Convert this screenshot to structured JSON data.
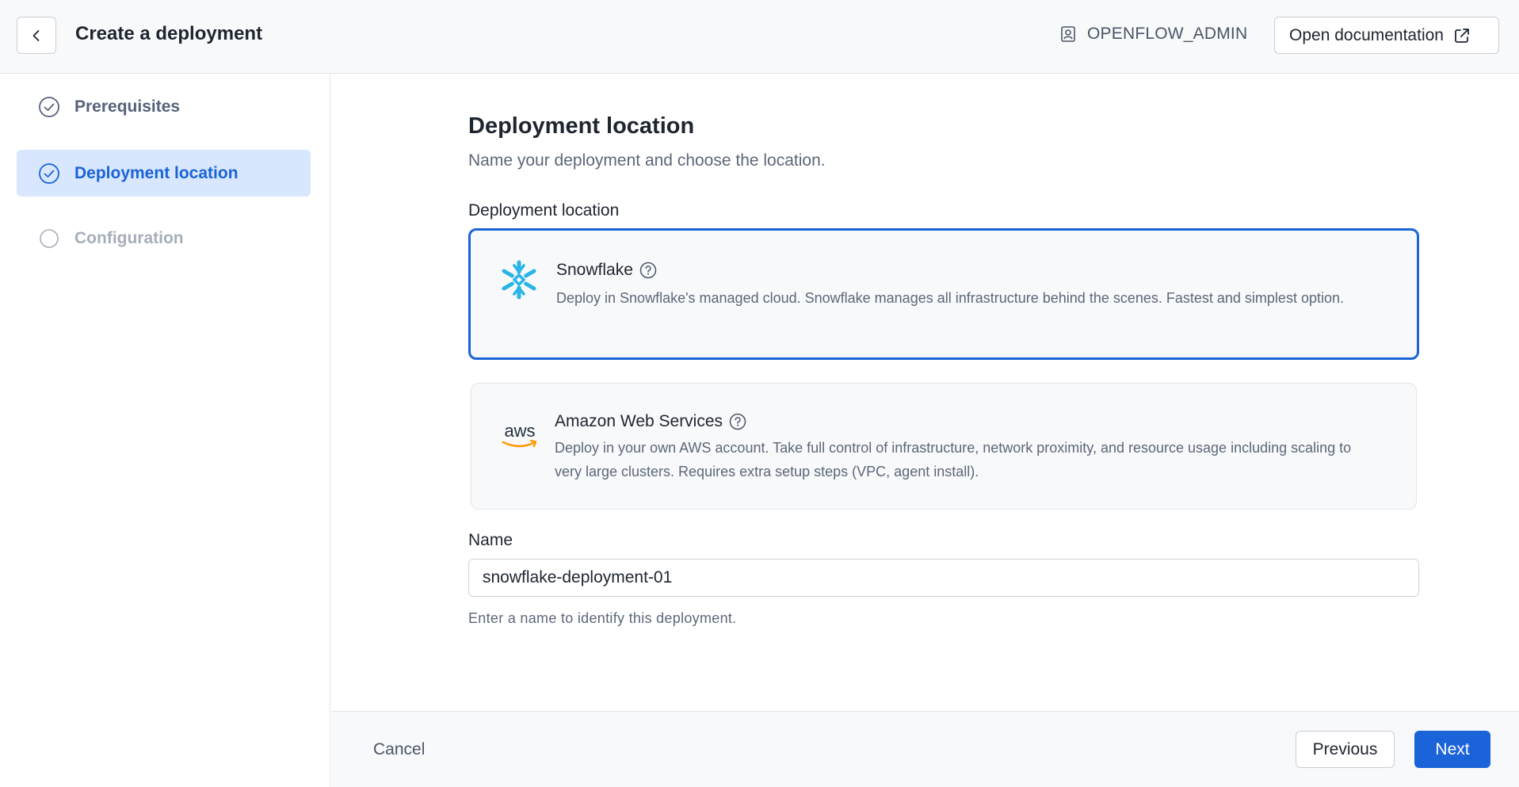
{
  "header": {
    "title": "Create a deployment",
    "user": "OPENFLOW_ADMIN",
    "doc_button": "Open documentation"
  },
  "steps": [
    {
      "label": "Prerequisites",
      "state": "done"
    },
    {
      "label": "Deployment location",
      "state": "active"
    },
    {
      "label": "Configuration",
      "state": "pending"
    }
  ],
  "main": {
    "title": "Deployment location",
    "subtitle": "Name your deployment and choose the location.",
    "location_label": "Deployment location",
    "options": [
      {
        "title": "Snowflake",
        "description": "Deploy in Snowflake's managed cloud. Snowflake manages all infrastructure behind the scenes. Fastest and simplest option.",
        "logo": "snowflake-logo",
        "selected": true
      },
      {
        "title": "Amazon Web Services",
        "description": "Deploy in your own AWS account. Take full control of infrastructure, network proximity, and resource usage including scaling to very large clusters. Requires extra setup steps (VPC, agent install).",
        "logo": "aws-logo",
        "logo_text": "aws",
        "selected": false
      }
    ],
    "name_label": "Name",
    "name_value": "snowflake-deployment-01",
    "name_helper": "Enter a name to identify this deployment."
  },
  "footer": {
    "cancel": "Cancel",
    "previous": "Previous",
    "next": "Next"
  },
  "colors": {
    "accent": "#1a63d8",
    "active_step_bg": "#d8e7fd",
    "snowflake": "#29b5e8",
    "aws_orange": "#ff9900"
  }
}
